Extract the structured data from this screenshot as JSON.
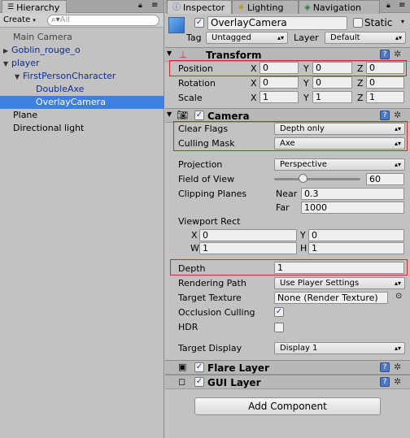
{
  "hierarchy": {
    "tab_label": "Hierarchy",
    "create_label": "Create",
    "search_placeholder": "All",
    "items": [
      {
        "label": "Main Camera"
      },
      {
        "label": "Goblin_rouge_o"
      },
      {
        "label": "player"
      },
      {
        "label": "FirstPersonCharacter"
      },
      {
        "label": "DoubleAxe"
      },
      {
        "label": "OverlayCamera"
      },
      {
        "label": "Plane"
      },
      {
        "label": "Directional light"
      }
    ]
  },
  "inspector": {
    "tabs": [
      "Inspector",
      "Lighting",
      "Navigation"
    ],
    "object_name": "OverlayCamera",
    "static_label": "Static",
    "tag_label": "Tag",
    "tag_value": "Untagged",
    "layer_label": "Layer",
    "layer_value": "Default",
    "transform": {
      "title": "Transform",
      "position_label": "Position",
      "rotation_label": "Rotation",
      "scale_label": "Scale",
      "axis_x": "X",
      "axis_y": "Y",
      "axis_z": "Z",
      "position": [
        "0",
        "0",
        "0"
      ],
      "rotation": [
        "0",
        "0",
        "0"
      ],
      "scale": [
        "1",
        "1",
        "1"
      ]
    },
    "camera": {
      "title": "Camera",
      "clear_flags_label": "Clear Flags",
      "clear_flags_value": "Depth only",
      "culling_mask_label": "Culling Mask",
      "culling_mask_value": "Axe",
      "projection_label": "Projection",
      "projection_value": "Perspective",
      "fov_label": "Field of View",
      "fov_value": "60",
      "clipping_label": "Clipping Planes",
      "near_label": "Near",
      "near_value": "0.3",
      "far_label": "Far",
      "far_value": "1000",
      "viewport_label": "Viewport Rect",
      "vx_label": "X",
      "vx_value": "0",
      "vy_label": "Y",
      "vy_value": "0",
      "vw_label": "W",
      "vw_value": "1",
      "vh_label": "H",
      "vh_value": "1",
      "depth_label": "Depth",
      "depth_value": "1",
      "rendering_path_label": "Rendering Path",
      "rendering_path_value": "Use Player Settings",
      "target_texture_label": "Target Texture",
      "target_texture_value": "None (Render Texture)",
      "occlusion_label": "Occlusion Culling",
      "hdr_label": "HDR",
      "target_display_label": "Target Display",
      "target_display_value": "Display 1"
    },
    "flare_layer_title": "Flare Layer",
    "gui_layer_title": "GUI Layer",
    "add_component_label": "Add Component"
  }
}
